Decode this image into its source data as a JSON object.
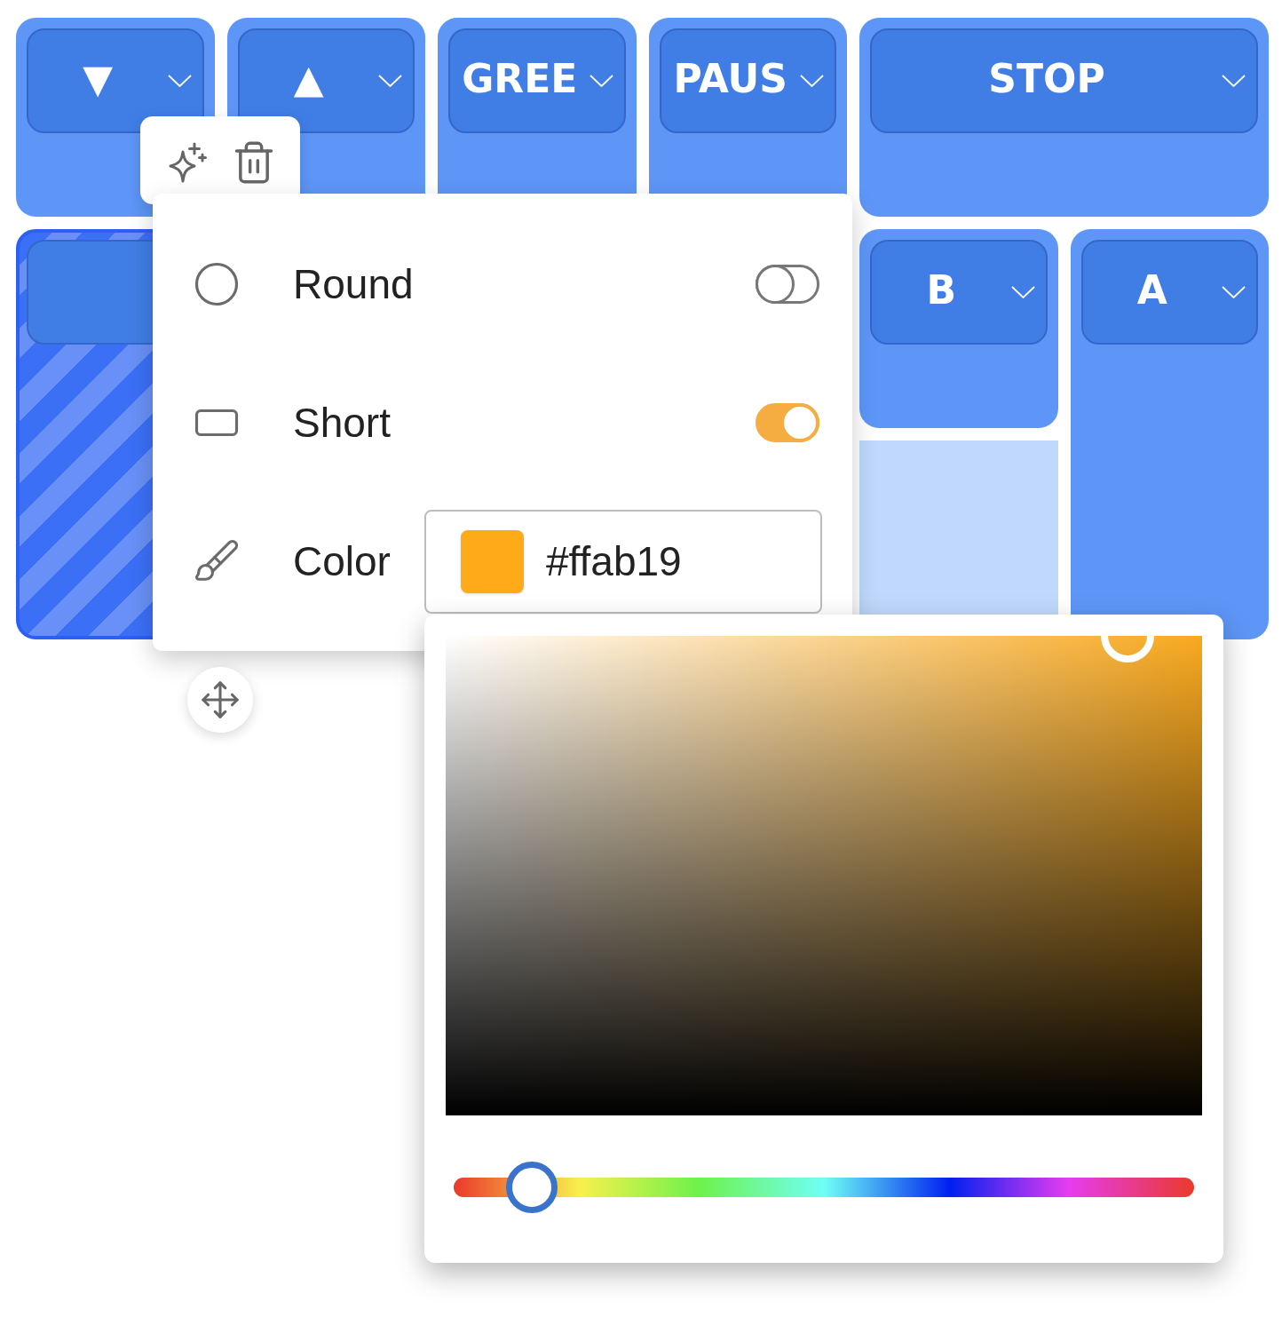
{
  "tiles": [
    {
      "kind": "button",
      "label": "▼",
      "selected": false
    },
    {
      "kind": "button",
      "label": "▲",
      "selected": false
    },
    {
      "kind": "button",
      "label": "GREE",
      "selected": false
    },
    {
      "kind": "button",
      "label": "PAUS",
      "selected": false
    },
    {
      "kind": "button",
      "label": "STOP",
      "selected": false
    },
    {
      "kind": "button",
      "selected": true
    },
    {
      "kind": "button",
      "label": "B",
      "selected": false
    },
    {
      "kind": "button",
      "label": "A",
      "selected": false
    },
    {
      "kind": "empty",
      "selected": false
    }
  ],
  "settings_menu": {
    "items": [
      {
        "kind": "toggle",
        "label": "Round",
        "on": false
      },
      {
        "kind": "toggle",
        "label": "Short",
        "on": true
      },
      {
        "kind": "color",
        "label": "Color",
        "value": "#ffab19"
      }
    ]
  },
  "color_picker": {
    "hue_slider": {
      "level": 0.105
    }
  }
}
